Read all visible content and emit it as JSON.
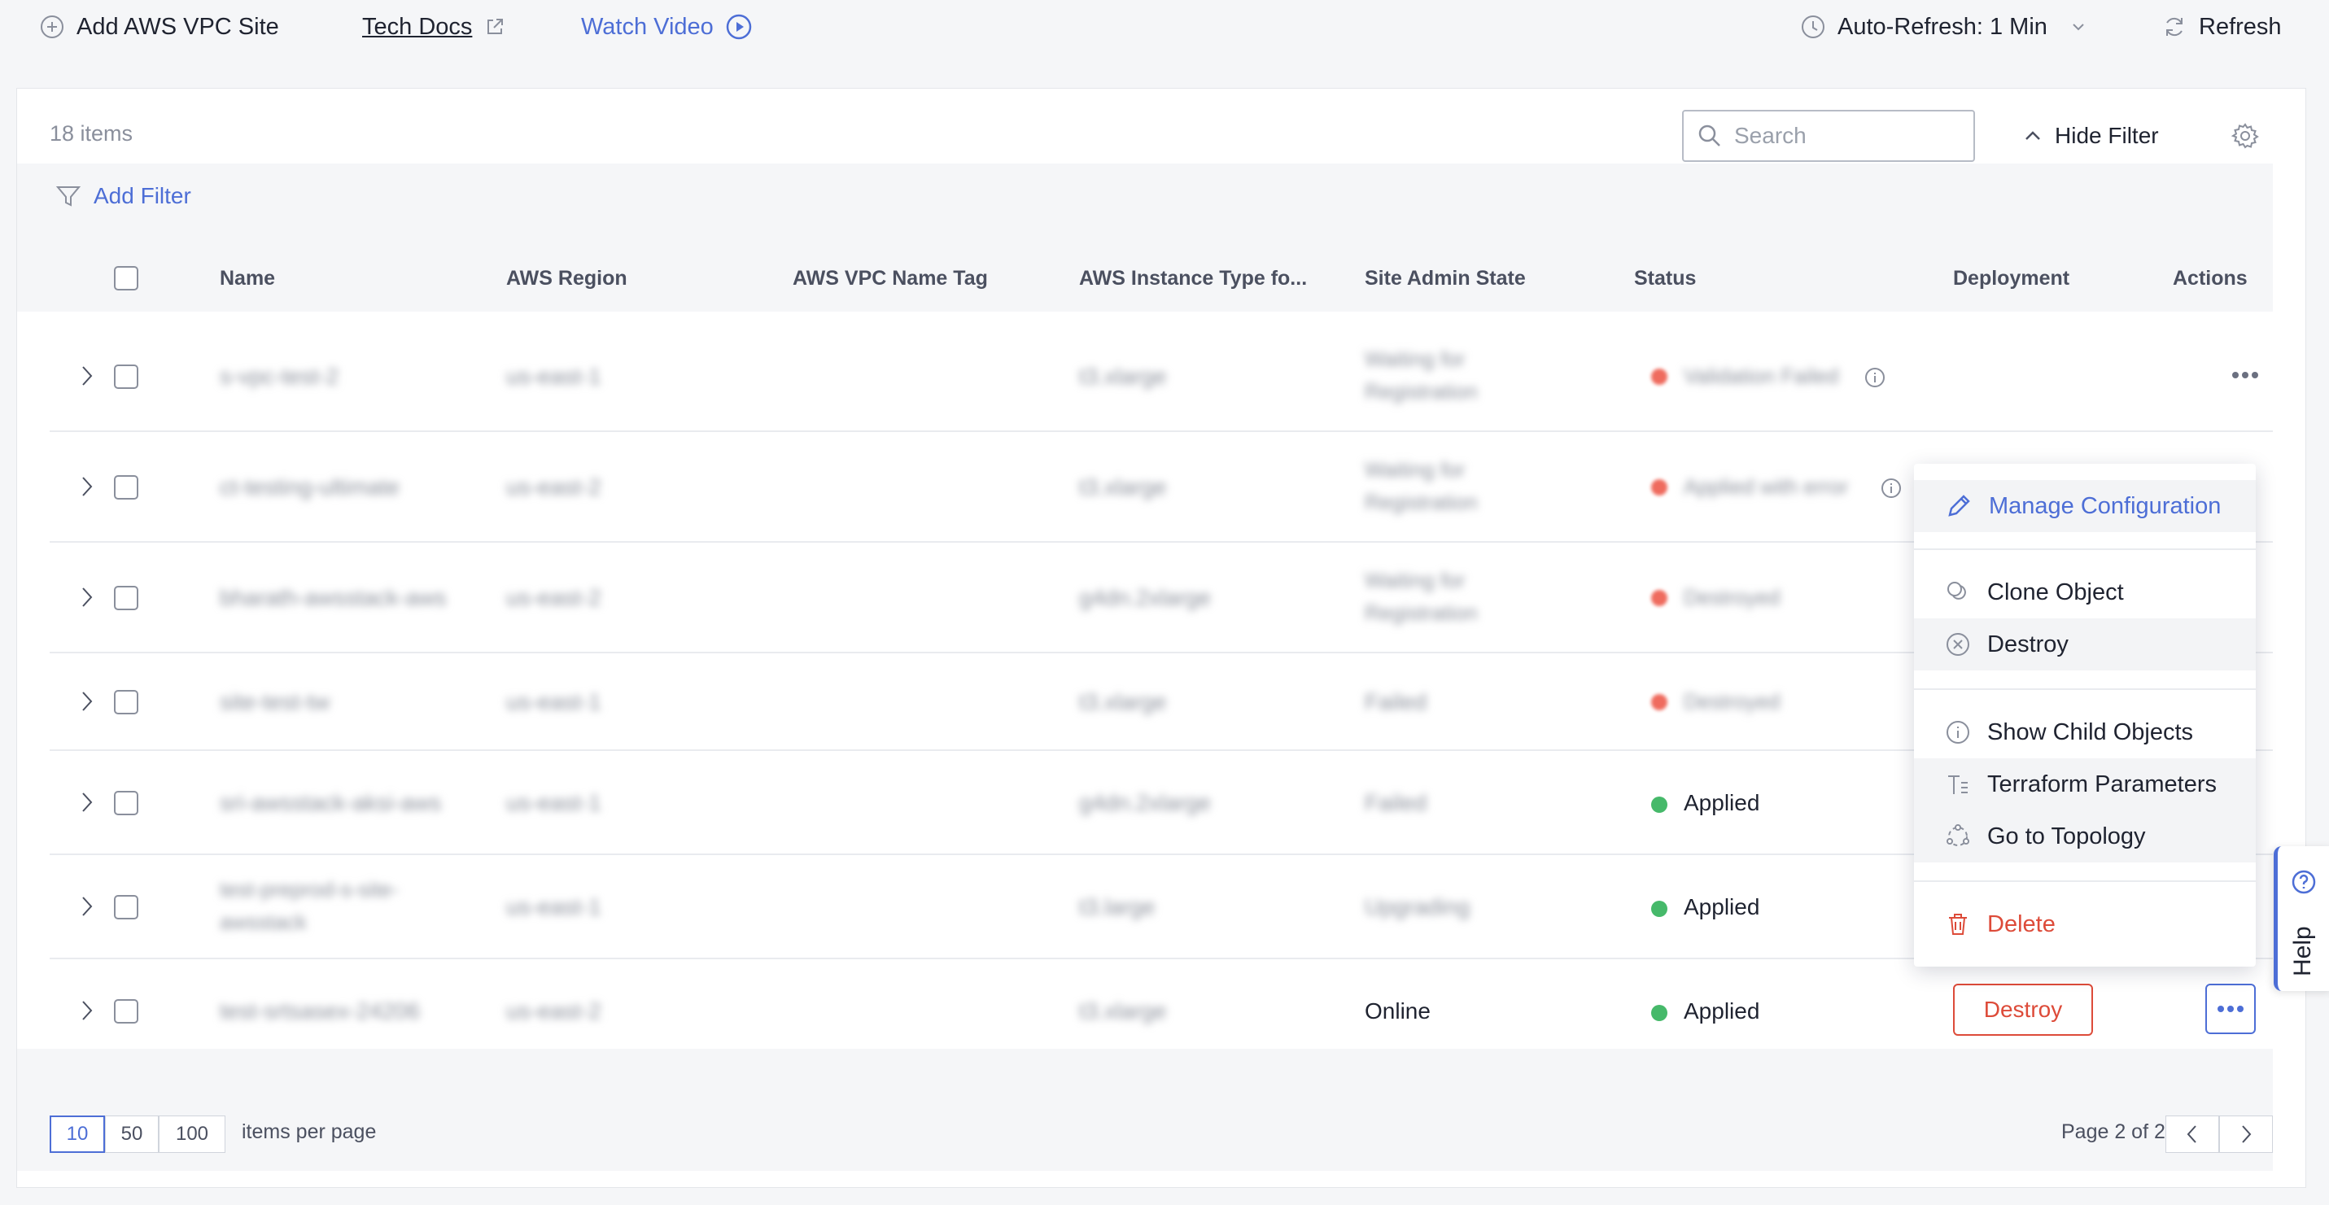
{
  "topbar": {
    "add_site": "Add AWS VPC Site",
    "tech_docs": "Tech Docs",
    "watch_video": "Watch Video",
    "auto_refresh": "Auto-Refresh: 1 Min",
    "refresh": "Refresh"
  },
  "table_toolbar": {
    "item_count": "18 items",
    "search_placeholder": "Search",
    "hide_filter": "Hide Filter",
    "add_filter": "Add Filter"
  },
  "columns": [
    "Name",
    "AWS Region",
    "AWS VPC Name Tag",
    "AWS Instance Type fo...",
    "Site Admin State",
    "Status",
    "Deployment",
    "Actions"
  ],
  "rows": [
    {
      "name": "s-vpc-test-2",
      "region": "us-east-1",
      "vpc_tag": "",
      "instance": "t3.xlarge",
      "admin_state": "Waiting for Registration",
      "status": "Validation Failed",
      "status_color": "#ef6b5e"
    },
    {
      "name": "ct-testing-ultimate",
      "region": "us-east-2",
      "vpc_tag": "",
      "instance": "t3.xlarge",
      "admin_state": "Waiting for Registration",
      "status": "Applied with error",
      "status_color": "#ef6b5e"
    },
    {
      "name": "bharath-awsstack-aws",
      "region": "us-east-2",
      "vpc_tag": "",
      "instance": "g4dn.2xlarge",
      "admin_state": "Waiting for Registration",
      "status": "Destroyed",
      "status_color": "#ef6b5e"
    },
    {
      "name": "site-test-tw",
      "region": "us-east-1",
      "vpc_tag": "",
      "instance": "t3.xlarge",
      "admin_state": "Failed",
      "status": "Destroyed",
      "status_color": "#ef6b5e"
    },
    {
      "name": "sri-awsstack-aksi-aws",
      "region": "us-east-1",
      "vpc_tag": "",
      "instance": "g4dn.2xlarge",
      "admin_state": "Failed",
      "status": "Applied",
      "status_color": "#46b96a"
    },
    {
      "name": "test-preprod-s-site-awsstack",
      "region": "us-east-1",
      "vpc_tag": "",
      "instance": "t3.large",
      "admin_state": "Upgrading",
      "status": "Applied",
      "status_color": "#46b96a"
    },
    {
      "name": "test-srtsasex-24206",
      "region": "us-east-2",
      "vpc_tag": "",
      "instance": "t3.xlarge",
      "admin_state": "Online",
      "status": "Applied",
      "status_color": "#46b96a",
      "deployment_action": "Destroy"
    }
  ],
  "actions_menu": {
    "manage_configuration": "Manage Configuration",
    "clone_object": "Clone Object",
    "destroy": "Destroy",
    "show_child_objects": "Show Child Objects",
    "terraform_parameters": "Terraform Parameters",
    "go_to_topology": "Go to Topology",
    "delete": "Delete"
  },
  "pagination": {
    "per_page_options": [
      "10",
      "50",
      "100"
    ],
    "selected_per_page": "10",
    "items_per_page_label": "items per page",
    "page_info": "Page 2 of 2"
  },
  "help": "Help",
  "colors": {
    "accent": "#4d6ed6",
    "danger": "#dd4b39",
    "success": "#46b96a",
    "error": "#ef6b5e"
  }
}
